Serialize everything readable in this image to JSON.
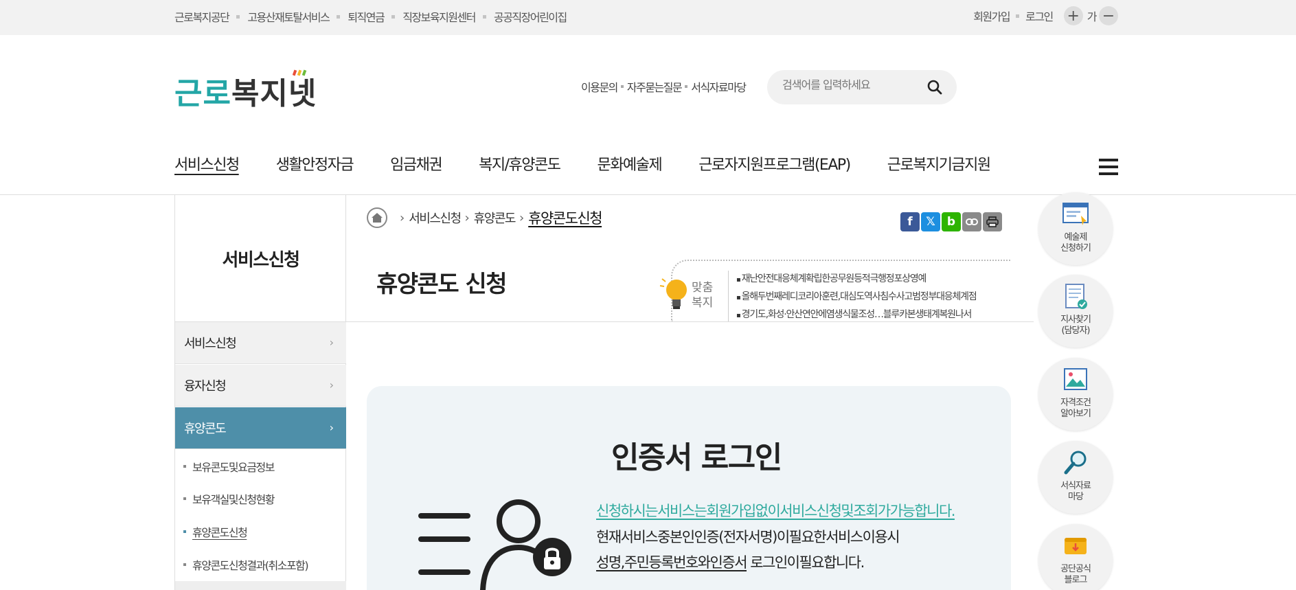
{
  "topbar": {
    "links": [
      "근로복지공단",
      "고용산재토탈서비스",
      "퇴직연금",
      "직장보육지원센터",
      "공공직장어린이집"
    ],
    "join": "회원가입",
    "login": "로그인",
    "font_plus": "+",
    "font_ga": "가",
    "font_minus": "−"
  },
  "header": {
    "logo_part1": "근로",
    "logo_part2": "복지넷",
    "links": [
      "이용문의",
      "자주묻는질문",
      "서식자료마당"
    ],
    "search_placeholder": "검색어를 입력하세요"
  },
  "gnb": {
    "items": [
      "서비스신청",
      "생활안정자금",
      "임금채권",
      "복지/휴양콘도",
      "문화예술제",
      "근로자지원프로그램(EAP)",
      "근로복지기금지원"
    ]
  },
  "lnb": {
    "title": "서비스신청",
    "items": [
      {
        "label": "서비스신청"
      },
      {
        "label": "융자신청"
      },
      {
        "label": "휴양콘도"
      }
    ],
    "subitems": [
      "보유콘도및요금정보",
      "보유객실및신청현황",
      "휴양콘도신청",
      "휴양콘도신청결과(취소포함)"
    ]
  },
  "breadcrumb": {
    "items": [
      "서비스신청",
      "휴양콘도"
    ],
    "current": "휴양콘도신청"
  },
  "share": {
    "facebook": "f",
    "x": "𝕏",
    "blog": "b"
  },
  "page": {
    "title": "휴양콘도 신청"
  },
  "custom_welfare": {
    "label_line1": "맞춤",
    "label_line2": "복지",
    "items": [
      "재난안전대응체계확립한공무원등적극행정포상영예",
      "올해두번째레디코리아훈련,대심도역사침수사고범정부대응체계점",
      "경기도,화성·안산연안에염생식물조성…블루카본생태계복원나서"
    ]
  },
  "login": {
    "title": "인증서 로그인",
    "desc1": "신청하시는서비스는회원가입없이서비스신청및조회가가능합니다.",
    "desc2": "현재서비스중본인인증(전자서명)이필요한서비스이용시",
    "desc3_u": "성명,주민등록번호와인증서",
    "desc3_rest": " 로그인이필요합니다."
  },
  "quick_menu": [
    {
      "label1": "예술제",
      "label2": "신청하기",
      "icon": "art-apply-icon"
    },
    {
      "label1": "지사찾기",
      "label2": "(담당자)",
      "icon": "branch-find-icon"
    },
    {
      "label1": "자격조건",
      "label2": "알아보기",
      "icon": "eligibility-icon"
    },
    {
      "label1": "서식자료",
      "label2": "마당",
      "icon": "forms-search-icon"
    },
    {
      "label1": "공단공식",
      "label2": "블로그",
      "icon": "blog-icon"
    }
  ],
  "colors": {
    "brand_teal": "#23a6a6",
    "lnb_active": "#4e8fa9",
    "notice_green": "#2faa9e"
  }
}
